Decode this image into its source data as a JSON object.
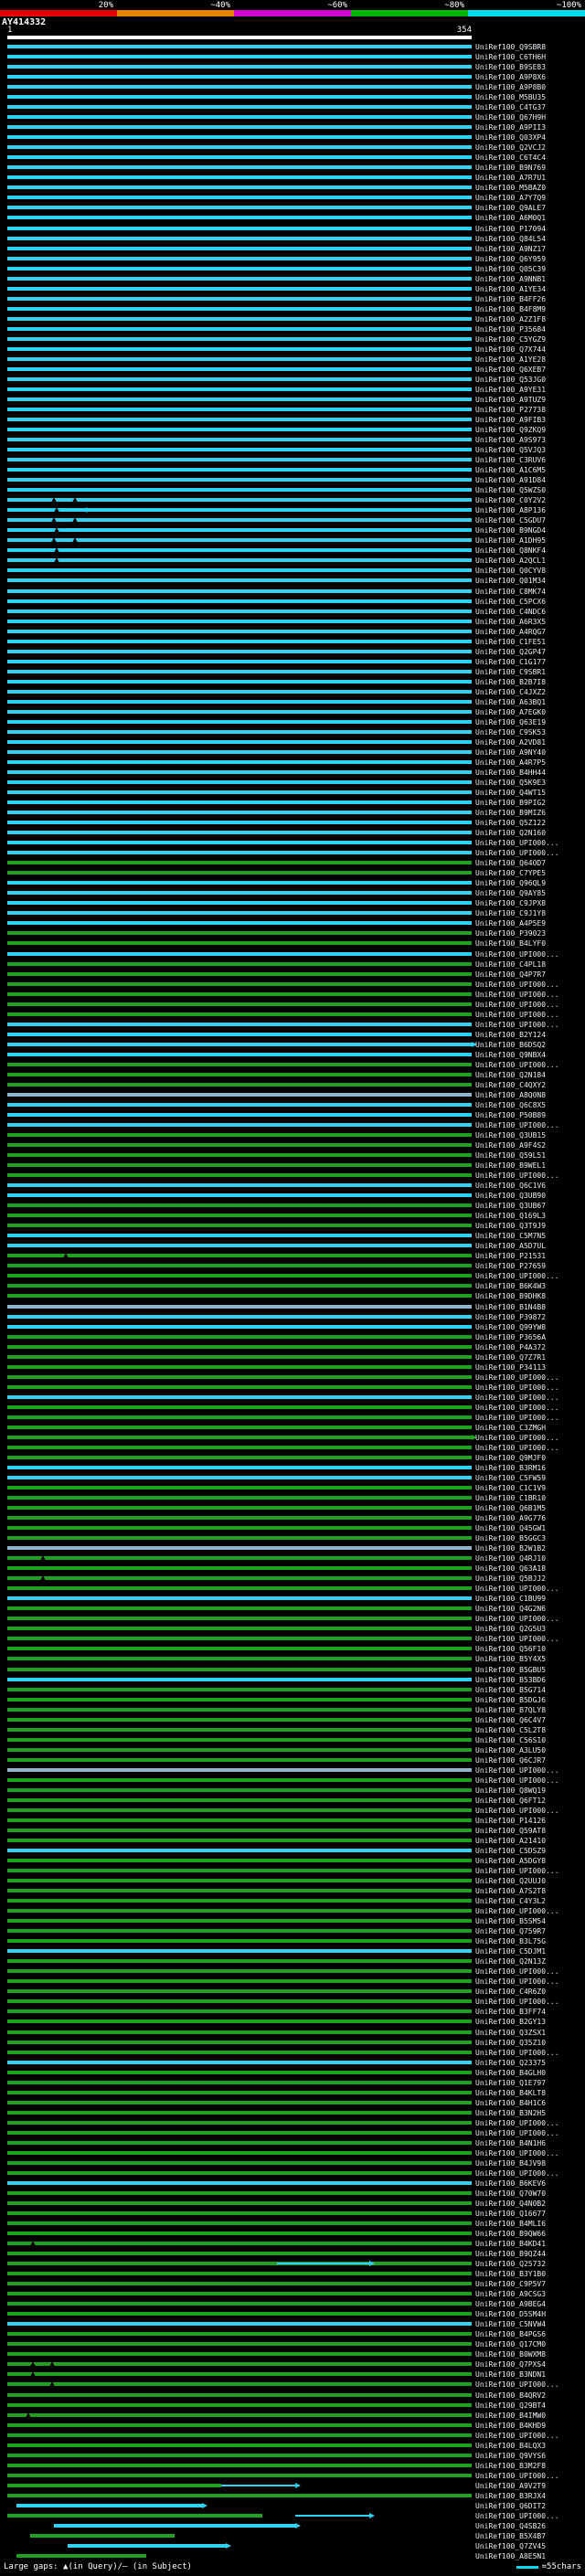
{
  "chart_data": {
    "type": "bar",
    "orientation": "horizontal",
    "title": "AY414332",
    "x_range": [
      1,
      354
    ],
    "id_prefix": "UniRef100_",
    "legend": {
      "position": "top",
      "labels": [
        "20%",
        "~40%",
        "~60%",
        "~80%",
        "~100%"
      ],
      "colors": [
        "#e00000",
        "#e78200",
        "#d400d4",
        "#00b400",
        "#00d8ec"
      ]
    },
    "palette": {
      "c": "#2fd2f2",
      "g": "#1ea31e",
      "t": "#8fb4cf"
    },
    "rows": [
      {
        "i": "Q9SBR8"
      },
      {
        "i": "C6TH6H"
      },
      {
        "i": "B9SE83"
      },
      {
        "i": "A9P8X6"
      },
      {
        "i": "A9P8B0"
      },
      {
        "i": "M5BU35"
      },
      {
        "i": "C4TG37"
      },
      {
        "i": "Q67H9H"
      },
      {
        "i": "A9PII3"
      },
      {
        "i": "Q03XP4"
      },
      {
        "i": "Q2VCJ2"
      },
      {
        "i": "C6T4C4"
      },
      {
        "i": "B9N769"
      },
      {
        "i": "A7R7U1"
      },
      {
        "i": "M5BAZ0"
      },
      {
        "i": "A7Y7Q9"
      },
      {
        "i": "Q9ALE7"
      },
      {
        "i": "A6M0Q1"
      },
      {
        "i": "P17094"
      },
      {
        "i": "Q84L54"
      },
      {
        "i": "A9NZ17"
      },
      {
        "i": "Q6Y959"
      },
      {
        "i": "Q05C39"
      },
      {
        "i": "A9NNB1"
      },
      {
        "i": "A1YE34"
      },
      {
        "i": "B4FF26"
      },
      {
        "i": "B4F8M9"
      },
      {
        "i": "A2Z1F8"
      },
      {
        "i": "P35684"
      },
      {
        "i": "C5YGZ9"
      },
      {
        "i": "Q7X744"
      },
      {
        "i": "A1YE28"
      },
      {
        "i": "Q6XEB7"
      },
      {
        "i": "Q53JG0"
      },
      {
        "i": "A9YE31"
      },
      {
        "i": "A9TUZ9"
      },
      {
        "i": "P27738"
      },
      {
        "i": "A9FIB3"
      },
      {
        "i": "Q9ZKQ9"
      },
      {
        "i": "A9S973"
      },
      {
        "i": "Q5VJQ3"
      },
      {
        "i": "C3RUV6"
      },
      {
        "i": "A1C6M5"
      },
      {
        "i": "A91D84"
      },
      {
        "i": "Q5WZS0"
      },
      {
        "i": "C0Y2V2",
        "m": [
          0.095,
          0.14
        ]
      },
      {
        "i": "A8P136",
        "m": [
          0.1
        ],
        "x": [
          {
            "s": 0.15,
            "e": 0.17,
            "c": "c",
            "a": true
          }
        ]
      },
      {
        "i": "C5GDU7",
        "m": [
          0.095,
          0.14
        ]
      },
      {
        "i": "B9NGD4",
        "m": [
          0.1
        ]
      },
      {
        "i": "A1DH95",
        "m": [
          0.095,
          0.14
        ]
      },
      {
        "i": "Q8NKF4",
        "m": [
          0.1
        ]
      },
      {
        "i": "A2QCL1",
        "m": [
          0.1
        ]
      },
      {
        "i": "Q0CYV8"
      },
      {
        "i": "Q01M34"
      },
      {
        "i": "C8MK74"
      },
      {
        "i": "C5PCX6"
      },
      {
        "i": "C4NDC6"
      },
      {
        "i": "A6R3X5"
      },
      {
        "i": "A4RQG7"
      },
      {
        "i": "C1FE51"
      },
      {
        "i": "Q2GP47"
      },
      {
        "i": "C1G177"
      },
      {
        "i": "C9SBR1"
      },
      {
        "i": "B2B7I8"
      },
      {
        "i": "C4JXZ2"
      },
      {
        "i": "A63BQ1"
      },
      {
        "i": "A7EGK0"
      },
      {
        "i": "Q63E19"
      },
      {
        "i": "C9SK53"
      },
      {
        "i": "A2VD81"
      },
      {
        "i": "A9NY40"
      },
      {
        "i": "A4R7P5"
      },
      {
        "i": "B4HH44"
      },
      {
        "i": "Q5K9E3"
      },
      {
        "i": "Q4WT15"
      },
      {
        "i": "B9PIG2"
      },
      {
        "i": "B9MIZ6"
      },
      {
        "i": "Q5Z122"
      },
      {
        "i": "Q2N160"
      },
      {
        "i": "UPI000..."
      },
      {
        "i": "UPI000..."
      },
      {
        "i": "Q64OD7",
        "c": "g"
      },
      {
        "i": "C7YPE5",
        "c": "g"
      },
      {
        "i": "Q96QL9"
      },
      {
        "i": "Q9AY85"
      },
      {
        "i": "C9JPX8"
      },
      {
        "i": "C9J1Y8"
      },
      {
        "i": "A4P5E9"
      },
      {
        "i": "P39023",
        "c": "g"
      },
      {
        "i": "B4LYF0",
        "c": "g"
      },
      {
        "i": "UPI000..."
      },
      {
        "i": "C4PL18",
        "c": "g"
      },
      {
        "i": "Q4P7R7",
        "c": "g"
      },
      {
        "i": "UPI000...",
        "c": "g"
      },
      {
        "i": "UPI000...",
        "c": "g"
      },
      {
        "i": "UPI000...",
        "c": "g"
      },
      {
        "i": "UPI000...",
        "c": "g"
      },
      {
        "i": "UPI000..."
      },
      {
        "i": "B2Y124"
      },
      {
        "i": "B6DSQ2",
        "a": true
      },
      {
        "i": "Q9NBX4"
      },
      {
        "i": "UPI000...",
        "c": "g"
      },
      {
        "i": "Q2N184",
        "c": "g"
      },
      {
        "i": "C4QXY2",
        "c": "g"
      },
      {
        "i": "A8Q0N8",
        "c": "t"
      },
      {
        "i": "Q6C8X5"
      },
      {
        "i": "P50B89"
      },
      {
        "i": "UPI000..."
      },
      {
        "i": "Q3UB15",
        "c": "g"
      },
      {
        "i": "A9F4S2",
        "c": "g"
      },
      {
        "i": "Q59L51",
        "c": "g"
      },
      {
        "i": "B9WEL1",
        "c": "g"
      },
      {
        "i": "UPI000...",
        "c": "g"
      },
      {
        "i": "Q6C1V6"
      },
      {
        "i": "Q3UB90"
      },
      {
        "i": "Q3UB67",
        "c": "g"
      },
      {
        "i": "Q169L3",
        "c": "g"
      },
      {
        "i": "Q3T9J9",
        "c": "g"
      },
      {
        "i": "C5M7N5"
      },
      {
        "i": "A5D7UL"
      },
      {
        "i": "P21531",
        "c": "g",
        "m": [
          0.12
        ]
      },
      {
        "i": "P27659",
        "c": "g"
      },
      {
        "i": "UPI000...",
        "c": "g"
      },
      {
        "i": "B6K4W3",
        "c": "g"
      },
      {
        "i": "B9DHK8",
        "c": "g"
      },
      {
        "i": "B1N4B8",
        "c": "t"
      },
      {
        "i": "P39872"
      },
      {
        "i": "Q99YW8"
      },
      {
        "i": "P3656A",
        "c": "g"
      },
      {
        "i": "P4A372",
        "c": "g"
      },
      {
        "i": "Q7Z7R1",
        "c": "g"
      },
      {
        "i": "P34113",
        "c": "g"
      },
      {
        "i": "UPI000...",
        "c": "g"
      },
      {
        "i": "UPI000...",
        "c": "g"
      },
      {
        "i": "UPI000..."
      },
      {
        "i": "UPI000...",
        "c": "g"
      },
      {
        "i": "UPI000...",
        "c": "g"
      },
      {
        "i": "C3ZMGH",
        "c": "g"
      },
      {
        "i": "UPI000...",
        "c": "g",
        "a": true
      },
      {
        "i": "UPI000...",
        "c": "g"
      },
      {
        "i": "Q9MJF0",
        "c": "g"
      },
      {
        "i": "B3RM16"
      },
      {
        "i": "C5FW59"
      },
      {
        "i": "C1C1V9",
        "c": "g"
      },
      {
        "i": "C1BR10",
        "c": "g"
      },
      {
        "i": "Q6B1M5",
        "c": "g"
      },
      {
        "i": "A9G776",
        "c": "g"
      },
      {
        "i": "Q45GW1",
        "c": "g"
      },
      {
        "i": "B5GGC3",
        "c": "g"
      },
      {
        "i": "B2W1B2",
        "c": "t"
      },
      {
        "i": "Q4RJ10",
        "c": "g",
        "m": [
          0.07
        ]
      },
      {
        "i": "Q63A18",
        "c": "g"
      },
      {
        "i": "Q5BJJ2",
        "c": "g",
        "m": [
          0.07
        ]
      },
      {
        "i": "UPI000...",
        "c": "g"
      },
      {
        "i": "C1BU99"
      },
      {
        "i": "Q4G2N6",
        "c": "g"
      },
      {
        "i": "UPI000...",
        "c": "g"
      },
      {
        "i": "Q2G5U3",
        "c": "g"
      },
      {
        "i": "UPI000...",
        "c": "g"
      },
      {
        "i": "Q56F10",
        "c": "g"
      },
      {
        "i": "B5Y4X5",
        "c": "g"
      },
      {
        "i": "B5GBU5",
        "c": "g"
      },
      {
        "i": "B53BD6"
      },
      {
        "i": "B5G714",
        "c": "g"
      },
      {
        "i": "B5DGJ6",
        "c": "g"
      },
      {
        "i": "B7QLY8",
        "c": "g"
      },
      {
        "i": "Q6C4V7",
        "c": "g"
      },
      {
        "i": "C5L2T8",
        "c": "g"
      },
      {
        "i": "C56S10",
        "c": "g"
      },
      {
        "i": "A3LU50",
        "c": "g"
      },
      {
        "i": "Q6CJR7",
        "c": "g"
      },
      {
        "i": "UPI000...",
        "c": "t"
      },
      {
        "i": "UPI000...",
        "c": "g"
      },
      {
        "i": "Q8WQ19",
        "c": "g"
      },
      {
        "i": "Q6FT12",
        "c": "g"
      },
      {
        "i": "UPI000...",
        "c": "g"
      },
      {
        "i": "P14126",
        "c": "g"
      },
      {
        "i": "Q59AT8",
        "c": "g"
      },
      {
        "i": "A21410",
        "c": "g"
      },
      {
        "i": "C5DSZ9"
      },
      {
        "i": "A5DGY8",
        "c": "g"
      },
      {
        "i": "UPI000...",
        "c": "g"
      },
      {
        "i": "Q2UUJ0",
        "c": "g"
      },
      {
        "i": "A7S2T8",
        "c": "g"
      },
      {
        "i": "C4Y3L2",
        "c": "g"
      },
      {
        "i": "UPI000...",
        "c": "g"
      },
      {
        "i": "B5SM54",
        "c": "g"
      },
      {
        "i": "Q759R7",
        "c": "g"
      },
      {
        "i": "B3L75G",
        "c": "g"
      },
      {
        "i": "C5DJM1"
      },
      {
        "i": "Q2N13Z",
        "c": "g"
      },
      {
        "i": "UPI000...",
        "c": "g"
      },
      {
        "i": "UPI000...",
        "c": "g"
      },
      {
        "i": "C4R6Z0",
        "c": "g"
      },
      {
        "i": "UPI000...",
        "c": "g"
      },
      {
        "i": "B3FF74",
        "c": "g"
      },
      {
        "i": "B2GY13",
        "c": "g"
      },
      {
        "i": "Q3ZSX1",
        "c": "g"
      },
      {
        "i": "Q35Z10",
        "c": "g"
      },
      {
        "i": "UPI000...",
        "c": "g"
      },
      {
        "i": "Q23375"
      },
      {
        "i": "B4GLH0",
        "c": "g"
      },
      {
        "i": "Q1E797",
        "c": "g"
      },
      {
        "i": "B4KLT8",
        "c": "g"
      },
      {
        "i": "B4H1C6",
        "c": "g"
      },
      {
        "i": "B3N2H5",
        "c": "g"
      },
      {
        "i": "UPI000...",
        "c": "g"
      },
      {
        "i": "UPI000...",
        "c": "g"
      },
      {
        "i": "B4N1H6",
        "c": "g"
      },
      {
        "i": "UPI000...",
        "c": "g"
      },
      {
        "i": "B4JV98",
        "c": "g"
      },
      {
        "i": "UPI000...",
        "c": "g"
      },
      {
        "i": "B6KEV6"
      },
      {
        "i": "Q70W70",
        "c": "g"
      },
      {
        "i": "Q4N0B2",
        "c": "g"
      },
      {
        "i": "Q16677",
        "c": "g"
      },
      {
        "i": "B4MLI6",
        "c": "g"
      },
      {
        "i": "B9QW66",
        "c": "g"
      },
      {
        "i": "B4KD41",
        "c": "g",
        "m": [
          0.05
        ]
      },
      {
        "i": "B9QZ44",
        "c": "g"
      },
      {
        "i": "Q25732",
        "c": "g",
        "x": [
          {
            "s": 0.58,
            "e": 0.78,
            "c": "c",
            "a": true
          }
        ]
      },
      {
        "i": "B3Y1B0",
        "c": "g"
      },
      {
        "i": "C9P5V7",
        "c": "g"
      },
      {
        "i": "A9CSG3",
        "c": "g"
      },
      {
        "i": "A9BEG4",
        "c": "g"
      },
      {
        "i": "D5SM4H",
        "c": "g"
      },
      {
        "i": "C5NVW4"
      },
      {
        "i": "B4PGS6",
        "c": "g"
      },
      {
        "i": "Q17CM0",
        "c": "g"
      },
      {
        "i": "B0WXM8",
        "c": "g"
      },
      {
        "i": "Q7PXS4",
        "c": "g",
        "m": [
          0.05,
          0.09
        ]
      },
      {
        "i": "B3NDN1",
        "c": "g",
        "m": [
          0.05
        ]
      },
      {
        "i": "UPI000...",
        "c": "g",
        "m": [
          0.09
        ]
      },
      {
        "i": "B4QRV2",
        "c": "g"
      },
      {
        "i": "Q29BT4",
        "c": "g"
      },
      {
        "i": "B4IMW0",
        "c": "g",
        "m": [
          0.04
        ]
      },
      {
        "i": "B4KHD9",
        "c": "g"
      },
      {
        "i": "UPI000...",
        "c": "g"
      },
      {
        "i": "B4LQX3",
        "c": "g"
      },
      {
        "i": "Q9VYS6",
        "c": "g"
      },
      {
        "i": "B3M2F8",
        "c": "g"
      },
      {
        "i": "UPI000...",
        "c": "g"
      },
      {
        "i": "A9V2T9",
        "c": "g",
        "s": 0,
        "e": 0.46,
        "x": [
          {
            "s": 0.46,
            "e": 0.62,
            "c": "c",
            "a": true
          }
        ]
      },
      {
        "i": "B3RJX4",
        "c": "g"
      },
      {
        "i": "Q6DIT2",
        "s": 0.02,
        "e": 0.42,
        "a": true
      },
      {
        "i": "UPI000...",
        "c": "g",
        "s": 0,
        "e": 0.55,
        "x": [
          {
            "s": 0.62,
            "e": 0.78,
            "c": "c",
            "a": true
          }
        ]
      },
      {
        "i": "Q4SB26",
        "s": 0.1,
        "e": 0.62,
        "a": true
      },
      {
        "i": "B5X4B7",
        "c": "g",
        "s": 0.05,
        "e": 0.36
      },
      {
        "i": "Q7ZV45",
        "s": 0.13,
        "e": 0.47,
        "a": true
      },
      {
        "i": "A8E5N1",
        "c": "g",
        "s": 0.02,
        "e": 0.3
      }
    ]
  },
  "footer": {
    "left_text": "Large gaps: ▲(in Query)/— (in Subject)",
    "right_text": "=55chars",
    "right_dash_color": "#00d8ec"
  }
}
